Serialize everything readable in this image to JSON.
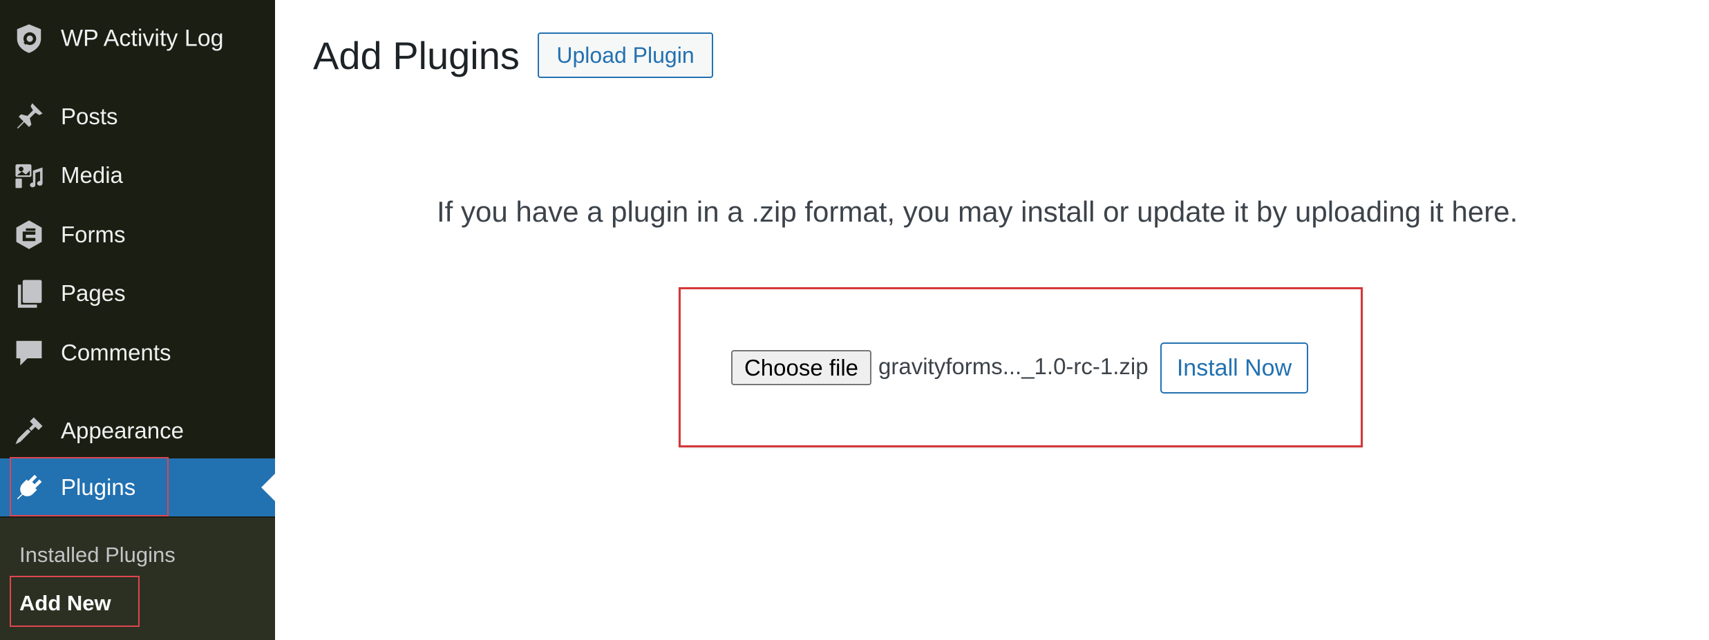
{
  "sidebar": {
    "brand": {
      "label": "WP Activity Log",
      "icon": "shield-icon"
    },
    "items": [
      {
        "label": "Posts",
        "icon": "pushpin-icon"
      },
      {
        "label": "Media",
        "icon": "media-icon"
      },
      {
        "label": "Forms",
        "icon": "gravity-forms-icon"
      },
      {
        "label": "Pages",
        "icon": "pages-icon"
      },
      {
        "label": "Comments",
        "icon": "comment-icon"
      },
      {
        "label": "Appearance",
        "icon": "paintbrush-icon"
      },
      {
        "label": "Plugins",
        "icon": "plugin-icon",
        "active": true
      }
    ],
    "submenu": [
      {
        "label": "Installed Plugins"
      },
      {
        "label": "Add New",
        "current": true
      }
    ]
  },
  "main": {
    "title": "Add Plugins",
    "upload_button": "Upload Plugin",
    "help_text": "If you have a plugin in a .zip format, you may install or update it by uploading it here.",
    "choose_file_button": "Choose file",
    "selected_file": "gravityforms..._1.0-rc-1.zip",
    "install_button": "Install Now"
  },
  "colors": {
    "sidebar_bg": "#1b1e12",
    "active_bg": "#2271b1",
    "accent": "#2271b1",
    "highlight_border": "#d63638"
  }
}
